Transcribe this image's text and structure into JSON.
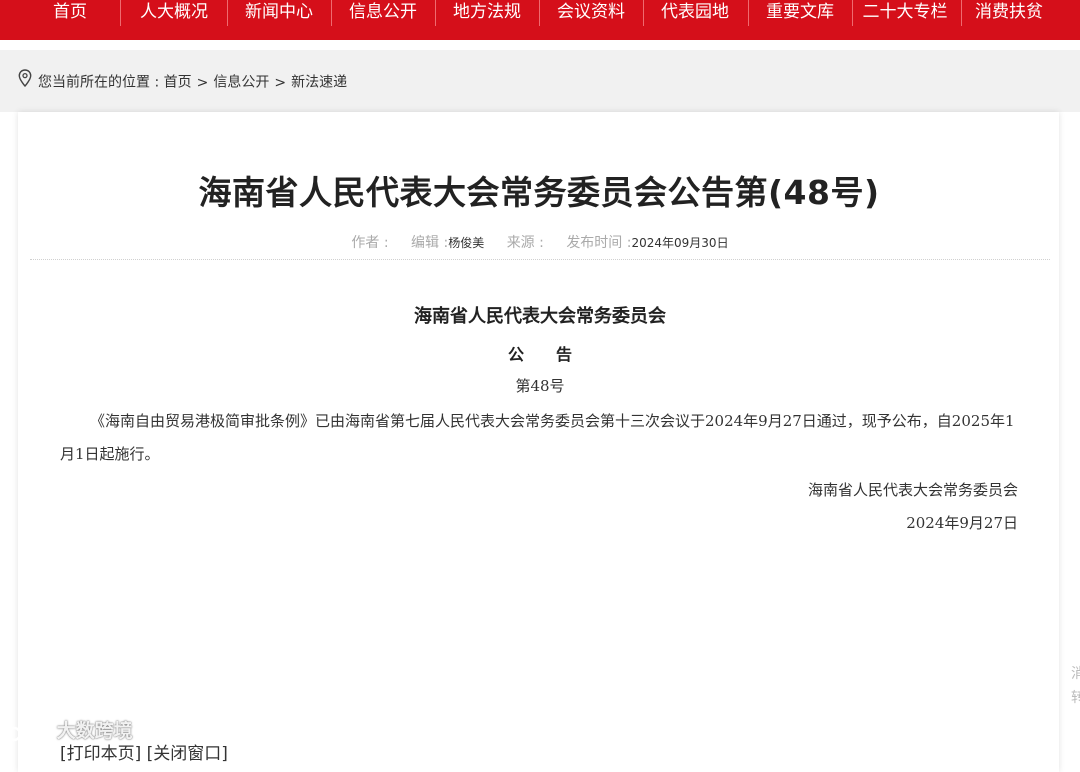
{
  "nav": {
    "items": [
      "首页",
      "人大概况",
      "新闻中心",
      "信息公开",
      "地方法规",
      "会议资料",
      "代表园地",
      "重要文库",
      "二十大专栏",
      "消费扶贫"
    ]
  },
  "breadcrumb": {
    "prefix": "您当前所在的位置 :",
    "home": "首页",
    "sep": ">",
    "level1": "信息公开",
    "level2": "新法速递"
  },
  "article": {
    "title": "海南省人民代表大会常务委员会公告第(48号)",
    "meta": {
      "author_label": "作者 :",
      "author": "",
      "editor_label": "编辑 :",
      "editor": "杨俊美",
      "source_label": "来源 :",
      "source": "",
      "date_label": "发布时间 :",
      "date": "2024年09月30日"
    },
    "issuer": "海南省人民代表大会常务委员会",
    "notice": "公告",
    "number": "第48号",
    "body": "《海南自由贸易港极简审批条例》已由海南省第七届人民代表大会常务委员会第十三次会议于2024年9月27日通过，现予公布，自2025年1月1日起施行。",
    "sign_org": "海南省人民代表大会常务委员会",
    "sign_date": "2024年9月27日"
  },
  "footer": {
    "print": "[打印本页]",
    "close": "[关闭窗口]"
  },
  "watermark": "大数跨境",
  "side_float": "消转",
  "colors": {
    "brand_red": "#d50f1a",
    "band_gray": "#f1f1f1"
  }
}
